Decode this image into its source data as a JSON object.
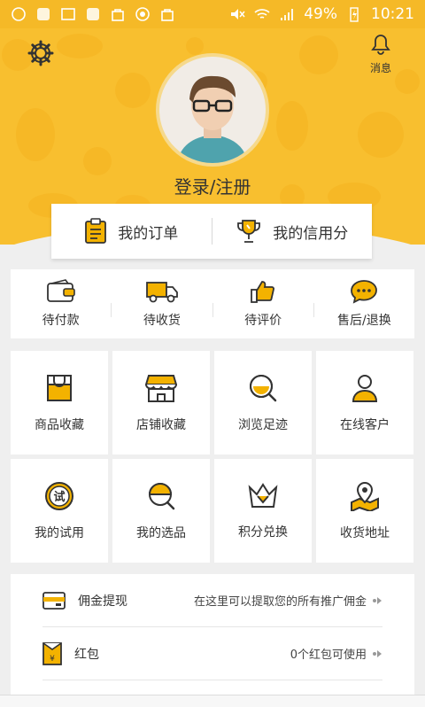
{
  "status_bar": {
    "battery": "49%",
    "time": "10:21"
  },
  "colors": {
    "brand": "#f8bf2f",
    "accent": "#f3b200",
    "icon_stroke": "#333333"
  },
  "header": {
    "settings_icon": "gear-icon",
    "messages_label": "消息",
    "login_label": "登录/注册"
  },
  "order_card": {
    "my_orders": "我的订单",
    "my_credit": "我的信用分"
  },
  "order_status": [
    {
      "label": "待付款",
      "icon": "wallet-icon"
    },
    {
      "label": "待收货",
      "icon": "truck-icon"
    },
    {
      "label": "待评价",
      "icon": "thumbs-up-icon"
    },
    {
      "label": "售后/退换",
      "icon": "chat-bubble-icon"
    }
  ],
  "grid": [
    {
      "label": "商品收藏",
      "icon": "shopping-bag-icon"
    },
    {
      "label": "店铺收藏",
      "icon": "store-icon"
    },
    {
      "label": "浏览足迹",
      "icon": "search-icon"
    },
    {
      "label": "在线客户",
      "icon": "customer-service-icon"
    },
    {
      "label": "我的试用",
      "icon": "trial-badge-icon"
    },
    {
      "label": "我的选品",
      "icon": "selection-icon"
    },
    {
      "label": "积分兑换",
      "icon": "crown-icon"
    },
    {
      "label": "收货地址",
      "icon": "location-map-icon"
    }
  ],
  "list": [
    {
      "label": "佣金提现",
      "desc": "在这里可以提取您的所有推广佣金",
      "icon": "card-icon"
    },
    {
      "label": "红包",
      "desc": "0个红包可使用",
      "icon": "red-packet-icon"
    }
  ]
}
